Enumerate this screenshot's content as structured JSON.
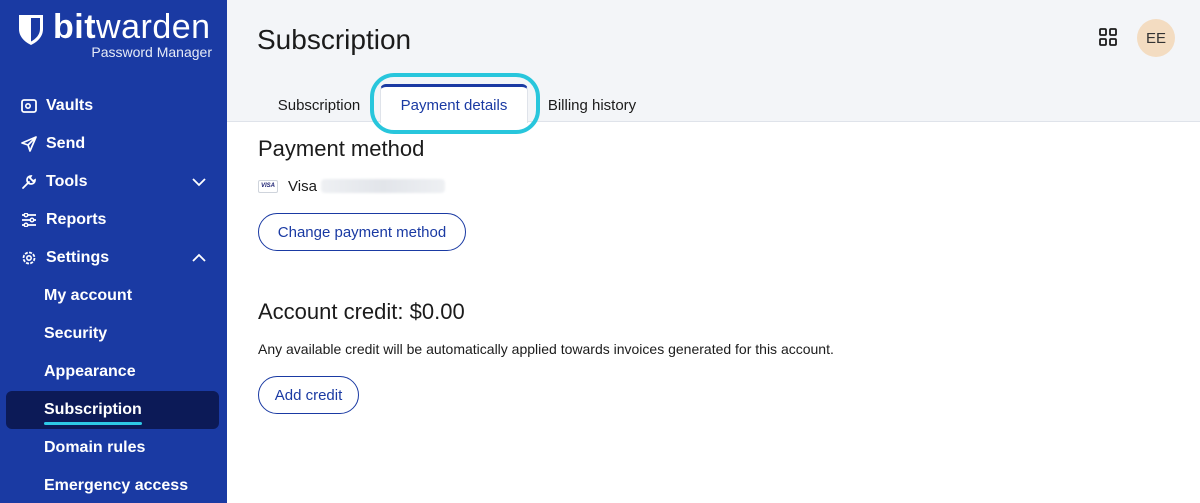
{
  "app": {
    "brand_bold": "bit",
    "brand_regular": "warden",
    "product": "Password Manager"
  },
  "sidebar": {
    "items": [
      {
        "label": "Vaults",
        "icon": "vault-icon"
      },
      {
        "label": "Send",
        "icon": "send-icon"
      },
      {
        "label": "Tools",
        "icon": "wrench-icon",
        "expanded": false
      },
      {
        "label": "Reports",
        "icon": "sliders-icon"
      },
      {
        "label": "Settings",
        "icon": "gear-icon",
        "expanded": true
      }
    ],
    "settings_children": [
      {
        "label": "My account"
      },
      {
        "label": "Security"
      },
      {
        "label": "Appearance"
      },
      {
        "label": "Subscription",
        "active": true
      },
      {
        "label": "Domain rules"
      },
      {
        "label": "Emergency access"
      }
    ]
  },
  "header": {
    "title": "Subscription",
    "avatar_initials": "EE",
    "avatar_color": "#f3dcc1"
  },
  "tabs": [
    {
      "label": "Subscription"
    },
    {
      "label": "Payment details",
      "active": true
    },
    {
      "label": "Billing history"
    }
  ],
  "payment": {
    "heading": "Payment method",
    "card_brand_badge": "VISA",
    "card_label": "Visa",
    "change_button": "Change payment method"
  },
  "credit": {
    "heading": "Account credit: $0.00",
    "description": "Any available credit will be automatically applied towards invoices generated for this account.",
    "add_button": "Add credit"
  },
  "colors": {
    "sidebar_bg": "#1a3aa3",
    "active_item_bg": "#0c1a57",
    "accent": "#1a3aa3",
    "highlight": "#28c6dc"
  }
}
